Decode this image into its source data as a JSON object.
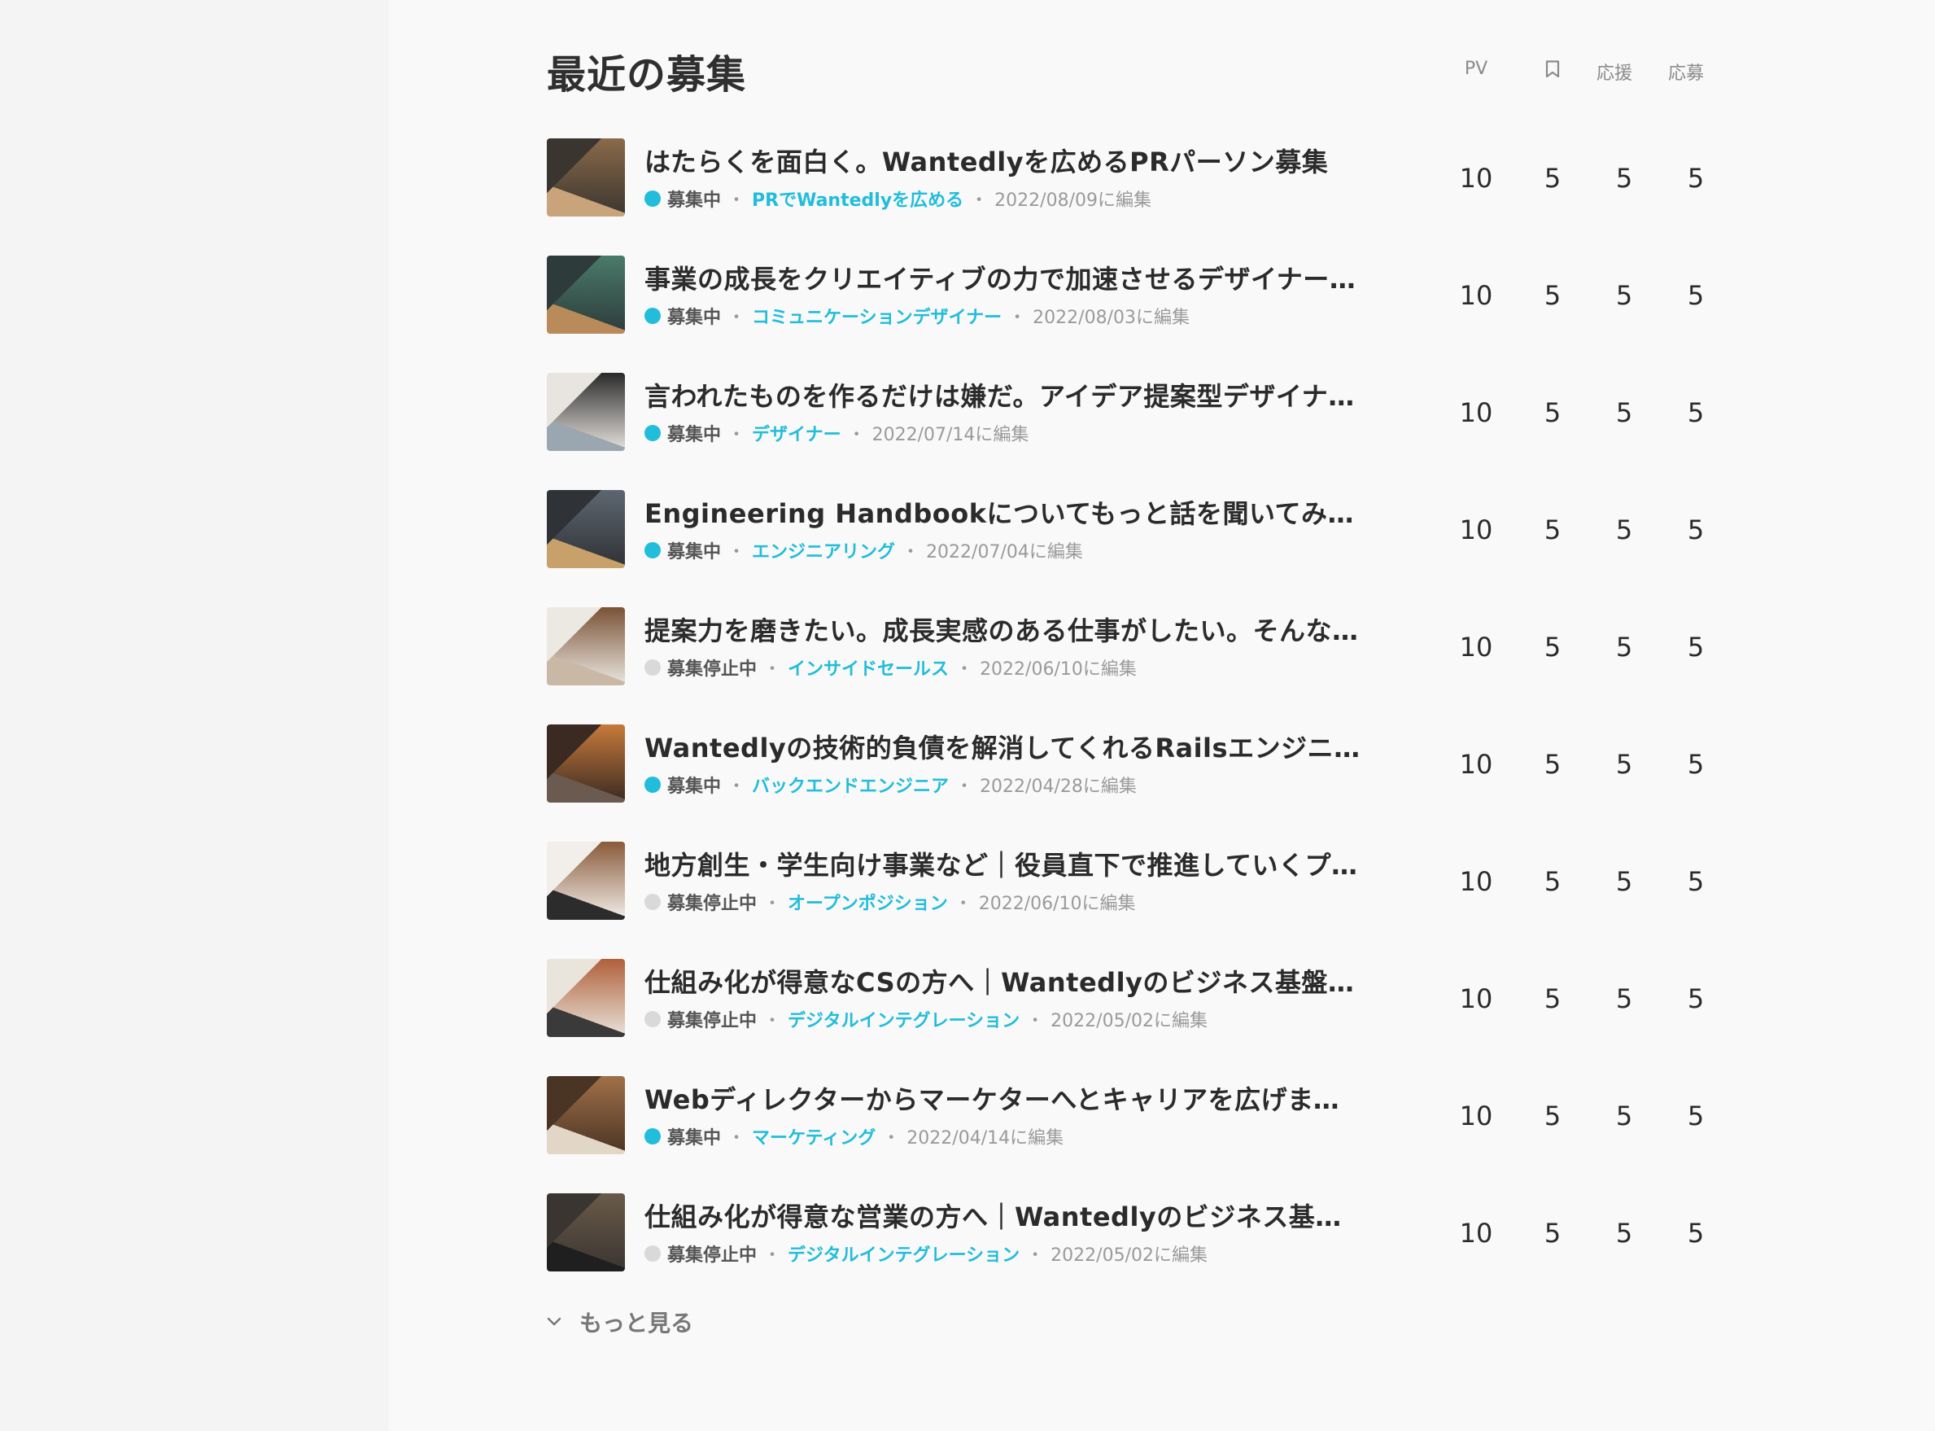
{
  "page": {
    "title": "最近の募集",
    "columns": {
      "pv": "PV",
      "bookmark_icon": "bookmark-icon",
      "cheer": "応援",
      "apply": "応募"
    },
    "more_label": "もっと見る"
  },
  "colors": {
    "active": "#21bddb",
    "stopped": "#d9d9d9",
    "link": "#21bddb"
  },
  "rows": [
    {
      "title": "はたらくを面白く。Wantedlyを広めるPRパーソン募集",
      "status": "募集中",
      "active": true,
      "role": "PRでWantedlyを広める",
      "edited": "2022/08/09に編集",
      "pv": "10",
      "bookmarks": "5",
      "cheers": "5",
      "applies": "5",
      "thumb": [
        "#3b3530",
        "#8a6a4a",
        "#c9a37a"
      ]
    },
    {
      "title": "事業の成長をクリエイティブの力で加速させるデザイナー…",
      "status": "募集中",
      "active": true,
      "role": "コミュニケーションデザイナー",
      "edited": "2022/08/03に編集",
      "pv": "10",
      "bookmarks": "5",
      "cheers": "5",
      "applies": "5",
      "thumb": [
        "#2d3b3a",
        "#4a7a6a",
        "#b98a5a"
      ]
    },
    {
      "title": "言われたものを作るだけは嫌だ。アイデア提案型デザイナ…",
      "status": "募集中",
      "active": true,
      "role": "デザイナー",
      "edited": "2022/07/14に編集",
      "pv": "10",
      "bookmarks": "5",
      "cheers": "5",
      "applies": "5",
      "thumb": [
        "#e8e4df",
        "#2a2a2a",
        "#9aa7b0"
      ]
    },
    {
      "title": "Engineering Handbookについてもっと話を聞いてみたい",
      "status": "募集中",
      "active": true,
      "role": "エンジニアリング",
      "edited": "2022/07/04に編集",
      "pv": "10",
      "bookmarks": "5",
      "cheers": "5",
      "applies": "5",
      "thumb": [
        "#2f3236",
        "#5d6670",
        "#c7a06a"
      ]
    },
    {
      "title": "提案力を磨きたい。成長実感のある仕事がしたい。そんな…",
      "status": "募集停止中",
      "active": false,
      "role": "インサイドセールス",
      "edited": "2022/06/10に編集",
      "pv": "10",
      "bookmarks": "5",
      "cheers": "5",
      "applies": "5",
      "thumb": [
        "#ece8e2",
        "#7a5236",
        "#c9b8a6"
      ]
    },
    {
      "title": "Wantedlyの技術的負債を解消してくれるRailsエンジニア…",
      "status": "募集中",
      "active": true,
      "role": "バックエンドエンジニア",
      "edited": "2022/04/28に編集",
      "pv": "10",
      "bookmarks": "5",
      "cheers": "5",
      "applies": "5",
      "thumb": [
        "#3a2a22",
        "#c77a3a",
        "#6a5a50"
      ]
    },
    {
      "title": "地方創生・学生向け事業など｜役員直下で推進していくプ…",
      "status": "募集停止中",
      "active": false,
      "role": "オープンポジション",
      "edited": "2022/06/10に編集",
      "pv": "10",
      "bookmarks": "5",
      "cheers": "5",
      "applies": "5",
      "thumb": [
        "#f2efea",
        "#8a5a3a",
        "#2c2c2c"
      ]
    },
    {
      "title": "仕組み化が得意なCSの方へ｜Wantedlyのビジネス基盤を…",
      "status": "募集停止中",
      "active": false,
      "role": "デジタルインテグレーション",
      "edited": "2022/05/02に編集",
      "pv": "10",
      "bookmarks": "5",
      "cheers": "5",
      "applies": "5",
      "thumb": [
        "#e9e4dc",
        "#b0603a",
        "#3a3a3a"
      ]
    },
    {
      "title": "Webディレクターからマーケターへとキャリアを広げませ…",
      "status": "募集中",
      "active": true,
      "role": "マーケティング",
      "edited": "2022/04/14に編集",
      "pv": "10",
      "bookmarks": "5",
      "cheers": "5",
      "applies": "5",
      "thumb": [
        "#4a3424",
        "#a07048",
        "#e2d6c6"
      ]
    },
    {
      "title": "仕組み化が得意な営業の方へ｜Wantedlyのビジネス基盤…",
      "status": "募集停止中",
      "active": false,
      "role": "デジタルインテグレーション",
      "edited": "2022/05/02に編集",
      "pv": "10",
      "bookmarks": "5",
      "cheers": "5",
      "applies": "5",
      "thumb": [
        "#3a3530",
        "#6a5a4a",
        "#1f1f1f"
      ]
    }
  ]
}
